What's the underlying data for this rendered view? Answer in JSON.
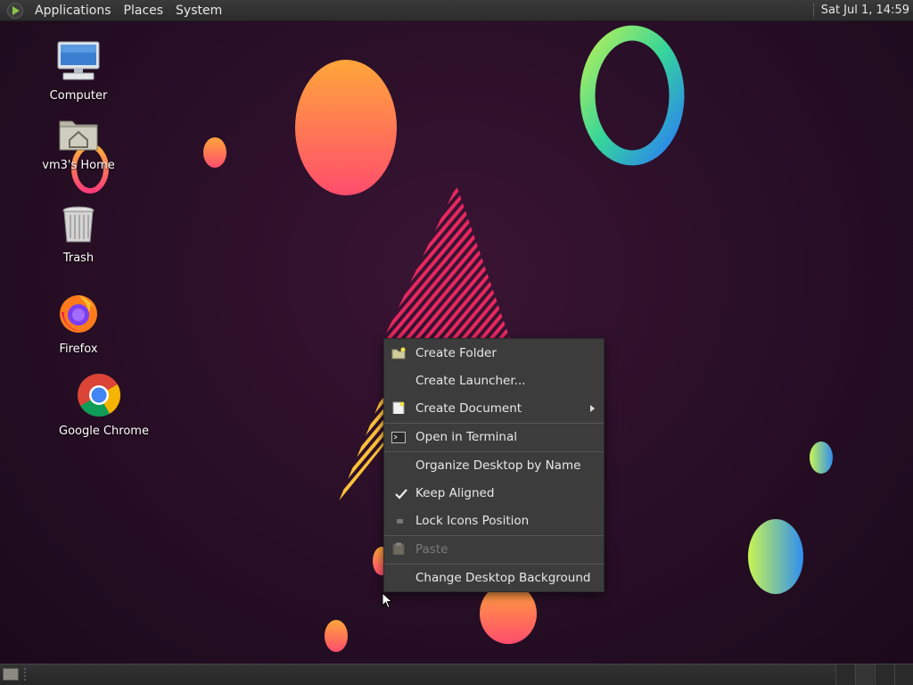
{
  "top_panel": {
    "menus": [
      "Applications",
      "Places",
      "System"
    ],
    "clock": "Sat Jul  1, 14:59"
  },
  "desktop_icons": [
    {
      "label": "Computer",
      "icon": "computer-icon"
    },
    {
      "label": "vm3's Home",
      "icon": "home-folder-icon"
    },
    {
      "label": "Trash",
      "icon": "trash-icon"
    },
    {
      "label": "Firefox",
      "icon": "firefox-icon"
    },
    {
      "label": "Google Chrome",
      "icon": "chrome-icon"
    }
  ],
  "context_menu": {
    "items": [
      {
        "label": "Create Folder",
        "icon": "folder-new-icon",
        "enabled": true
      },
      {
        "label": "Create Launcher...",
        "enabled": true
      },
      {
        "label": "Create Document",
        "icon": "document-new-icon",
        "enabled": true,
        "submenu": true
      },
      {
        "label": "Open in Terminal",
        "icon": "terminal-icon",
        "enabled": true
      },
      {
        "label": "Organize Desktop by Name",
        "enabled": true
      },
      {
        "label": "Keep Aligned",
        "icon": "check-icon",
        "enabled": true,
        "checked": true
      },
      {
        "label": "Lock Icons Position",
        "enabled": true,
        "checked": false
      },
      {
        "label": "Paste",
        "icon": "paste-icon",
        "enabled": false
      },
      {
        "label": "Change Desktop Background",
        "enabled": true
      }
    ]
  },
  "colors": {
    "panel": "#2c2c2c",
    "menu_bg": "#3c3c3c",
    "desktop_bg": "#2a0f28"
  }
}
